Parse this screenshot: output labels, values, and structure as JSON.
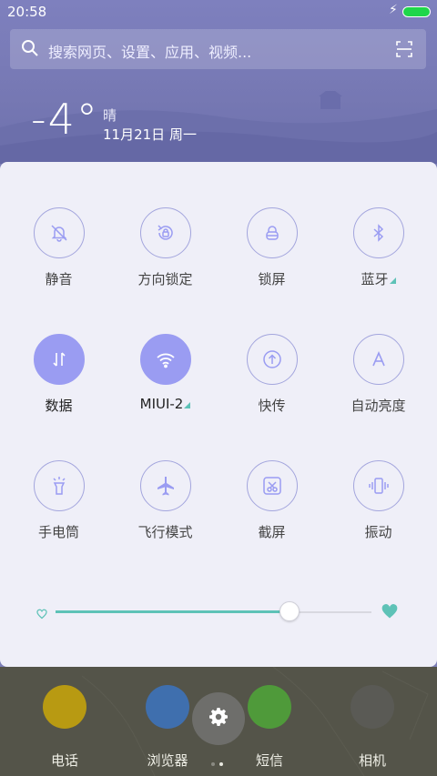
{
  "status_bar": {
    "time": "20:58",
    "charging_icon": "bolt-icon",
    "battery_color": "#1fd64a"
  },
  "search": {
    "placeholder": "搜索网页、设置、应用、视频...",
    "icon": "search-icon",
    "scan_icon": "scan-icon"
  },
  "weather": {
    "temperature": "-4°",
    "condition": "晴",
    "date": "11月21日 周一"
  },
  "toggles": [
    {
      "label": "静音",
      "icon": "mute-bell-icon",
      "active": false,
      "has_more": false
    },
    {
      "label": "方向锁定",
      "icon": "rotation-lock-icon",
      "active": false,
      "has_more": false
    },
    {
      "label": "锁屏",
      "icon": "lock-icon",
      "active": false,
      "has_more": false
    },
    {
      "label": "蓝牙",
      "icon": "bluetooth-icon",
      "active": false,
      "has_more": true
    },
    {
      "label": "数据",
      "icon": "mobile-data-icon",
      "active": true,
      "has_more": false
    },
    {
      "label": "MIUI-2",
      "icon": "wifi-icon",
      "active": true,
      "has_more": true
    },
    {
      "label": "快传",
      "icon": "quick-transfer-icon",
      "active": false,
      "has_more": false
    },
    {
      "label": "自动亮度",
      "icon": "auto-brightness-icon",
      "active": false,
      "has_more": false
    },
    {
      "label": "手电筒",
      "icon": "flashlight-icon",
      "active": false,
      "has_more": false
    },
    {
      "label": "飞行模式",
      "icon": "airplane-icon",
      "active": false,
      "has_more": false
    },
    {
      "label": "截屏",
      "icon": "screenshot-icon",
      "active": false,
      "has_more": false
    },
    {
      "label": "振动",
      "icon": "vibrate-icon",
      "active": false,
      "has_more": false
    }
  ],
  "brightness": {
    "level": 0.74,
    "accent": "#5ec2b7"
  },
  "dock": [
    {
      "label": "电话",
      "icon": "phone-icon",
      "color": "#b89a12"
    },
    {
      "label": "浏览器",
      "icon": "browser-icon",
      "color": "#3f6fae"
    },
    {
      "label": "短信",
      "icon": "message-icon",
      "color": "#4f9a3a"
    },
    {
      "label": "相机",
      "icon": "camera-icon",
      "color": "#5a5a55"
    }
  ],
  "settings_button": {
    "icon": "gear-icon"
  },
  "page_indicator": {
    "count": 2,
    "current": 2
  },
  "colors": {
    "accent": "#9a9cf2",
    "panel": "#efeff8",
    "header": "#7678b3"
  }
}
